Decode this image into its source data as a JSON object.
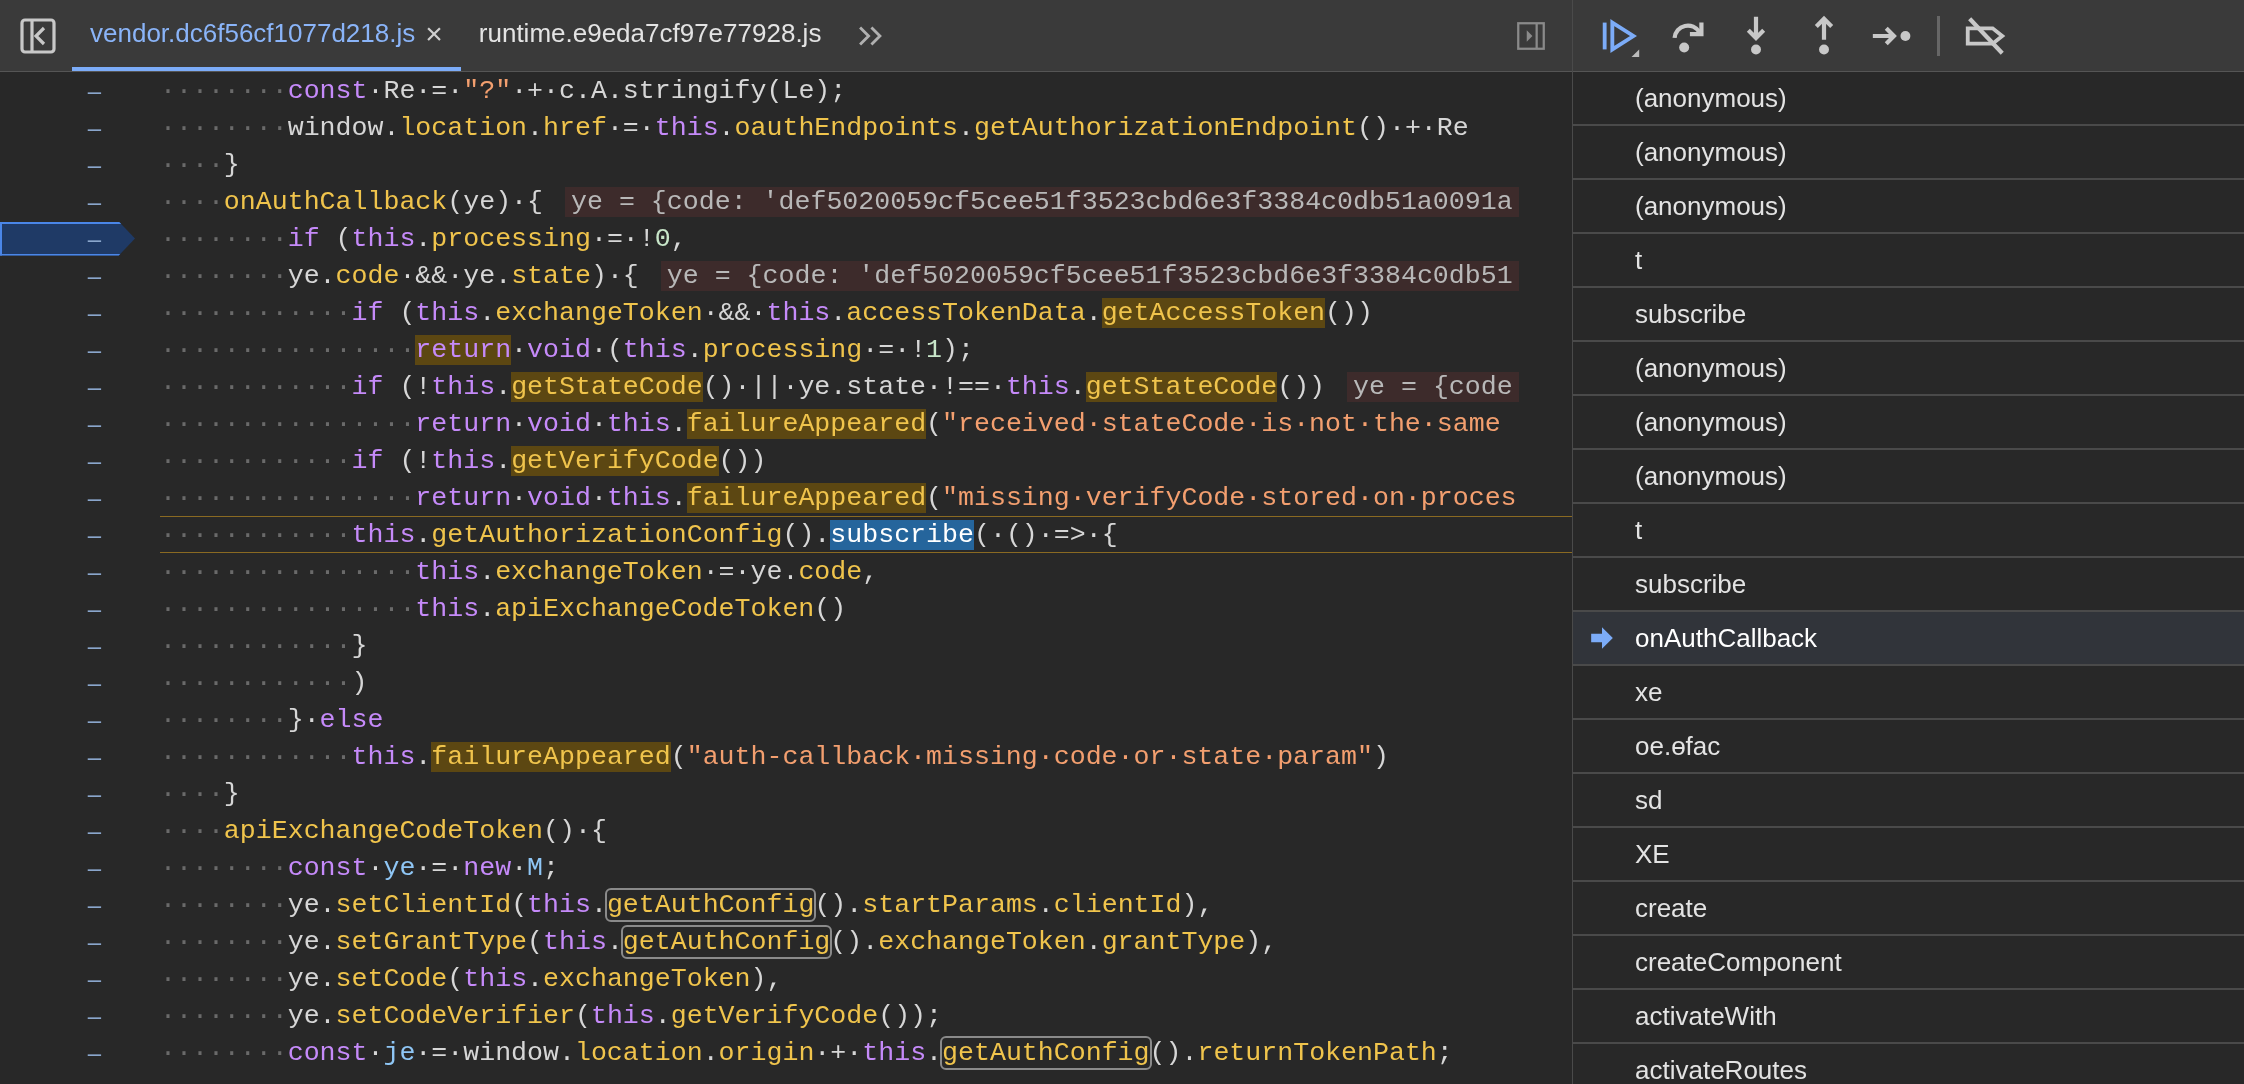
{
  "tabs": [
    {
      "label": "vendor.dc6f56cf1077d218.js",
      "selected": true,
      "close": "×"
    },
    {
      "label": "runtime.e9eda7cf97e77928.js",
      "selected": false
    }
  ],
  "lines": [
    {
      "marker": "–",
      "paused": false,
      "current": false,
      "indent": "········",
      "segments": [
        {
          "kind": "kw",
          "text": "const"
        },
        {
          "kind": "plain",
          "text": "·Re·=·"
        },
        {
          "kind": "str",
          "text": "\"?\""
        },
        {
          "kind": "plain",
          "text": "·+·c.A.stringify(Le);"
        }
      ]
    },
    {
      "marker": "–",
      "paused": false,
      "current": false,
      "indent": "········",
      "segments": [
        {
          "kind": "plain",
          "text": "window."
        },
        {
          "kind": "prop",
          "text": "location"
        },
        {
          "kind": "plain",
          "text": "."
        },
        {
          "kind": "prop",
          "text": "href"
        },
        {
          "kind": "plain",
          "text": "·=·"
        },
        {
          "kind": "kw",
          "text": "this"
        },
        {
          "kind": "plain",
          "text": "."
        },
        {
          "kind": "prop",
          "text": "oauthEndpoints"
        },
        {
          "kind": "plain",
          "text": "."
        },
        {
          "kind": "prop",
          "text": "getAuthorizationEndpoint"
        },
        {
          "kind": "plain",
          "text": "()·+·Re"
        }
      ]
    },
    {
      "marker": "–",
      "paused": false,
      "current": false,
      "indent": "····",
      "segments": [
        {
          "kind": "plain",
          "text": "}"
        }
      ]
    },
    {
      "marker": "–",
      "paused": false,
      "current": false,
      "indent": "····",
      "segments": [
        {
          "kind": "prop",
          "text": "onAuthCallback"
        },
        {
          "kind": "plain",
          "text": "(ye)·{"
        }
      ],
      "inline_value": "ye = {code: 'def5020059cf5cee51f3523cbd6e3f3384c0db51a0091a"
    },
    {
      "marker": "–",
      "paused": true,
      "current": false,
      "indent": "········",
      "segments": [
        {
          "kind": "kw",
          "text": "if"
        },
        {
          "kind": "plain",
          "text": " ("
        },
        {
          "kind": "kw",
          "text": "this"
        },
        {
          "kind": "plain",
          "text": "."
        },
        {
          "kind": "prop",
          "text": "processing"
        },
        {
          "kind": "plain",
          "text": "·=·!"
        },
        {
          "kind": "num",
          "text": "0"
        },
        {
          "kind": "plain",
          "text": ","
        }
      ]
    },
    {
      "marker": "–",
      "paused": false,
      "current": false,
      "indent": "········",
      "segments": [
        {
          "kind": "plain",
          "text": "ye."
        },
        {
          "kind": "prop",
          "text": "code"
        },
        {
          "kind": "plain",
          "text": "·&&·ye."
        },
        {
          "kind": "prop",
          "text": "state"
        },
        {
          "kind": "plain",
          "text": ")·{"
        }
      ],
      "inline_value": "ye = {code: 'def5020059cf5cee51f3523cbd6e3f3384c0db51"
    },
    {
      "marker": "–",
      "paused": false,
      "current": false,
      "indent": "············",
      "segments": [
        {
          "kind": "kw",
          "text": "if"
        },
        {
          "kind": "plain",
          "text": " ("
        },
        {
          "kind": "kw",
          "text": "this"
        },
        {
          "kind": "plain",
          "text": "."
        },
        {
          "kind": "prop",
          "text": "exchangeToken"
        },
        {
          "kind": "plain",
          "text": "·&&·"
        },
        {
          "kind": "kw",
          "text": "this"
        },
        {
          "kind": "plain",
          "text": "."
        },
        {
          "kind": "prop",
          "text": "accessTokenData"
        },
        {
          "kind": "plain",
          "text": "."
        },
        {
          "kind": "match",
          "text": "getAccessToken"
        },
        {
          "kind": "plain",
          "text": "())"
        }
      ]
    },
    {
      "marker": "–",
      "paused": false,
      "current": false,
      "indent": "················",
      "segments": [
        {
          "kind": "kw-match",
          "text": "return"
        },
        {
          "kind": "plain",
          "text": "·"
        },
        {
          "kind": "kw",
          "text": "void"
        },
        {
          "kind": "plain",
          "text": "·("
        },
        {
          "kind": "kw",
          "text": "this"
        },
        {
          "kind": "plain",
          "text": "."
        },
        {
          "kind": "prop",
          "text": "processing"
        },
        {
          "kind": "plain",
          "text": "·=·!"
        },
        {
          "kind": "num",
          "text": "1"
        },
        {
          "kind": "plain",
          "text": ");"
        }
      ]
    },
    {
      "marker": "–",
      "paused": false,
      "current": false,
      "indent": "············",
      "segments": [
        {
          "kind": "kw",
          "text": "if"
        },
        {
          "kind": "plain",
          "text": " (!"
        },
        {
          "kind": "kw",
          "text": "this"
        },
        {
          "kind": "plain",
          "text": "."
        },
        {
          "kind": "match",
          "text": "getStateCode"
        },
        {
          "kind": "plain",
          "text": "()·||·ye.state·!==·"
        },
        {
          "kind": "kw",
          "text": "this"
        },
        {
          "kind": "plain",
          "text": "."
        },
        {
          "kind": "match",
          "text": "getStateCode"
        },
        {
          "kind": "plain",
          "text": "())"
        }
      ],
      "inline_value": "ye = {code"
    },
    {
      "marker": "–",
      "paused": false,
      "current": false,
      "indent": "················",
      "segments": [
        {
          "kind": "kw",
          "text": "return"
        },
        {
          "kind": "plain",
          "text": "·"
        },
        {
          "kind": "kw",
          "text": "void"
        },
        {
          "kind": "plain",
          "text": "·"
        },
        {
          "kind": "kw",
          "text": "this"
        },
        {
          "kind": "plain",
          "text": "."
        },
        {
          "kind": "match",
          "text": "failureAppeared"
        },
        {
          "kind": "plain",
          "text": "("
        },
        {
          "kind": "str",
          "text": "\"received·stateCode·is·not·the·same"
        }
      ]
    },
    {
      "marker": "–",
      "paused": false,
      "current": false,
      "indent": "············",
      "segments": [
        {
          "kind": "kw",
          "text": "if"
        },
        {
          "kind": "plain",
          "text": " (!"
        },
        {
          "kind": "kw",
          "text": "this"
        },
        {
          "kind": "plain",
          "text": "."
        },
        {
          "kind": "match",
          "text": "getVerifyCode"
        },
        {
          "kind": "plain",
          "text": "())"
        }
      ]
    },
    {
      "marker": "–",
      "paused": false,
      "current": false,
      "indent": "················",
      "segments": [
        {
          "kind": "kw",
          "text": "return"
        },
        {
          "kind": "plain",
          "text": "·"
        },
        {
          "kind": "kw",
          "text": "void"
        },
        {
          "kind": "plain",
          "text": "·"
        },
        {
          "kind": "kw",
          "text": "this"
        },
        {
          "kind": "plain",
          "text": "."
        },
        {
          "kind": "match",
          "text": "failureAppeared"
        },
        {
          "kind": "plain",
          "text": "("
        },
        {
          "kind": "str",
          "text": "\"missing·verifyCode·stored·on·proces"
        }
      ]
    },
    {
      "marker": "–",
      "paused": false,
      "current": true,
      "indent": "············",
      "segments": [
        {
          "kind": "kw",
          "text": "this"
        },
        {
          "kind": "plain",
          "text": "."
        },
        {
          "kind": "prop",
          "text": "getAuthorizationConfig"
        },
        {
          "kind": "plain",
          "text": "()."
        },
        {
          "kind": "current",
          "text": "subscribe"
        },
        {
          "kind": "plain",
          "text": "(·()·=>·{"
        }
      ]
    },
    {
      "marker": "–",
      "paused": false,
      "current": false,
      "indent": "················",
      "segments": [
        {
          "kind": "kw",
          "text": "this"
        },
        {
          "kind": "plain",
          "text": "."
        },
        {
          "kind": "prop",
          "text": "exchangeToken"
        },
        {
          "kind": "plain",
          "text": "·=·ye."
        },
        {
          "kind": "prop",
          "text": "code"
        },
        {
          "kind": "plain",
          "text": ","
        }
      ]
    },
    {
      "marker": "–",
      "paused": false,
      "current": false,
      "indent": "················",
      "segments": [
        {
          "kind": "kw",
          "text": "this"
        },
        {
          "kind": "plain",
          "text": "."
        },
        {
          "kind": "prop",
          "text": "apiExchangeCodeToken"
        },
        {
          "kind": "plain",
          "text": "()"
        }
      ]
    },
    {
      "marker": "–",
      "paused": false,
      "current": false,
      "indent": "············",
      "segments": [
        {
          "kind": "plain",
          "text": "}"
        }
      ]
    },
    {
      "marker": "–",
      "paused": false,
      "current": false,
      "indent": "············",
      "segments": [
        {
          "kind": "plain",
          "text": ")"
        }
      ]
    },
    {
      "marker": "–",
      "paused": false,
      "current": false,
      "indent": "········",
      "segments": [
        {
          "kind": "plain",
          "text": "}·"
        },
        {
          "kind": "kw",
          "text": "else"
        }
      ]
    },
    {
      "marker": "–",
      "paused": false,
      "current": false,
      "indent": "············",
      "segments": [
        {
          "kind": "kw",
          "text": "this"
        },
        {
          "kind": "plain",
          "text": "."
        },
        {
          "kind": "match",
          "text": "failureAppeared"
        },
        {
          "kind": "plain",
          "text": "("
        },
        {
          "kind": "str",
          "text": "\"auth-callback·missing·code·or·state·param\""
        },
        {
          "kind": "plain",
          "text": ")"
        }
      ]
    },
    {
      "marker": "–",
      "paused": false,
      "current": false,
      "indent": "····",
      "segments": [
        {
          "kind": "plain",
          "text": "}"
        }
      ]
    },
    {
      "marker": "–",
      "paused": false,
      "current": false,
      "indent": "····",
      "segments": [
        {
          "kind": "prop",
          "text": "apiExchangeCodeToken"
        },
        {
          "kind": "plain",
          "text": "()·{"
        }
      ]
    },
    {
      "marker": "–",
      "paused": false,
      "current": false,
      "indent": "········",
      "segments": [
        {
          "kind": "kw",
          "text": "const"
        },
        {
          "kind": "plain",
          "text": "·"
        },
        {
          "kind": "type",
          "text": "ye"
        },
        {
          "kind": "plain",
          "text": "·=·"
        },
        {
          "kind": "kw",
          "text": "new"
        },
        {
          "kind": "plain",
          "text": "·"
        },
        {
          "kind": "type",
          "text": "M"
        },
        {
          "kind": "plain",
          "text": ";"
        }
      ]
    },
    {
      "marker": "–",
      "paused": false,
      "current": false,
      "indent": "········",
      "segments": [
        {
          "kind": "plain",
          "text": "ye."
        },
        {
          "kind": "prop",
          "text": "setClientId"
        },
        {
          "kind": "plain",
          "text": "("
        },
        {
          "kind": "kw",
          "text": "this"
        },
        {
          "kind": "plain",
          "text": "."
        },
        {
          "kind": "boxed",
          "text": "getAuthConfig"
        },
        {
          "kind": "plain",
          "text": "()."
        },
        {
          "kind": "prop",
          "text": "startParams"
        },
        {
          "kind": "plain",
          "text": "."
        },
        {
          "kind": "prop",
          "text": "clientId"
        },
        {
          "kind": "plain",
          "text": "),"
        }
      ]
    },
    {
      "marker": "–",
      "paused": false,
      "current": false,
      "indent": "········",
      "segments": [
        {
          "kind": "plain",
          "text": "ye."
        },
        {
          "kind": "prop",
          "text": "setGrantType"
        },
        {
          "kind": "plain",
          "text": "("
        },
        {
          "kind": "kw",
          "text": "this"
        },
        {
          "kind": "plain",
          "text": "."
        },
        {
          "kind": "boxed",
          "text": "getAuthConfig"
        },
        {
          "kind": "plain",
          "text": "()."
        },
        {
          "kind": "prop",
          "text": "exchangeToken"
        },
        {
          "kind": "plain",
          "text": "."
        },
        {
          "kind": "prop",
          "text": "grantType"
        },
        {
          "kind": "plain",
          "text": "),"
        }
      ]
    },
    {
      "marker": "–",
      "paused": false,
      "current": false,
      "indent": "········",
      "segments": [
        {
          "kind": "plain",
          "text": "ye."
        },
        {
          "kind": "prop",
          "text": "setCode"
        },
        {
          "kind": "plain",
          "text": "("
        },
        {
          "kind": "kw",
          "text": "this"
        },
        {
          "kind": "plain",
          "text": "."
        },
        {
          "kind": "prop",
          "text": "exchangeToken"
        },
        {
          "kind": "plain",
          "text": "),"
        }
      ]
    },
    {
      "marker": "–",
      "paused": false,
      "current": false,
      "indent": "········",
      "segments": [
        {
          "kind": "plain",
          "text": "ye."
        },
        {
          "kind": "prop",
          "text": "setCodeVerifier"
        },
        {
          "kind": "plain",
          "text": "("
        },
        {
          "kind": "kw",
          "text": "this"
        },
        {
          "kind": "plain",
          "text": "."
        },
        {
          "kind": "prop",
          "text": "getVerifyCode"
        },
        {
          "kind": "plain",
          "text": "());"
        }
      ]
    },
    {
      "marker": "–",
      "paused": false,
      "current": false,
      "indent": "········",
      "segments": [
        {
          "kind": "kw",
          "text": "const"
        },
        {
          "kind": "plain",
          "text": "·"
        },
        {
          "kind": "type",
          "text": "je"
        },
        {
          "kind": "plain",
          "text": "·=·window."
        },
        {
          "kind": "prop",
          "text": "location"
        },
        {
          "kind": "plain",
          "text": "."
        },
        {
          "kind": "prop",
          "text": "origin"
        },
        {
          "kind": "plain",
          "text": "·+·"
        },
        {
          "kind": "kw",
          "text": "this"
        },
        {
          "kind": "plain",
          "text": "."
        },
        {
          "kind": "boxed",
          "text": "getAuthConfig"
        },
        {
          "kind": "plain",
          "text": "()."
        },
        {
          "kind": "prop",
          "text": "returnTokenPath"
        },
        {
          "kind": "plain",
          "text": ";"
        }
      ]
    }
  ],
  "call_stack": [
    {
      "name": "(anonymous)",
      "selected": false
    },
    {
      "name": "(anonymous)",
      "selected": false
    },
    {
      "name": "(anonymous)",
      "selected": false
    },
    {
      "name": "t",
      "selected": false
    },
    {
      "name": "subscribe",
      "selected": false
    },
    {
      "name": "(anonymous)",
      "selected": false
    },
    {
      "name": "(anonymous)",
      "selected": false
    },
    {
      "name": "(anonymous)",
      "selected": false
    },
    {
      "name": "t",
      "selected": false
    },
    {
      "name": "subscribe",
      "selected": false
    },
    {
      "name": "onAuthCallback",
      "selected": true
    },
    {
      "name": "xe",
      "selected": false
    },
    {
      "name": "oe.ɵfac",
      "selected": false
    },
    {
      "name": "sd",
      "selected": false
    },
    {
      "name": "XE",
      "selected": false
    },
    {
      "name": "create",
      "selected": false
    },
    {
      "name": "createComponent",
      "selected": false
    },
    {
      "name": "activateWith",
      "selected": false
    },
    {
      "name": "activateRoutes",
      "selected": false
    }
  ]
}
